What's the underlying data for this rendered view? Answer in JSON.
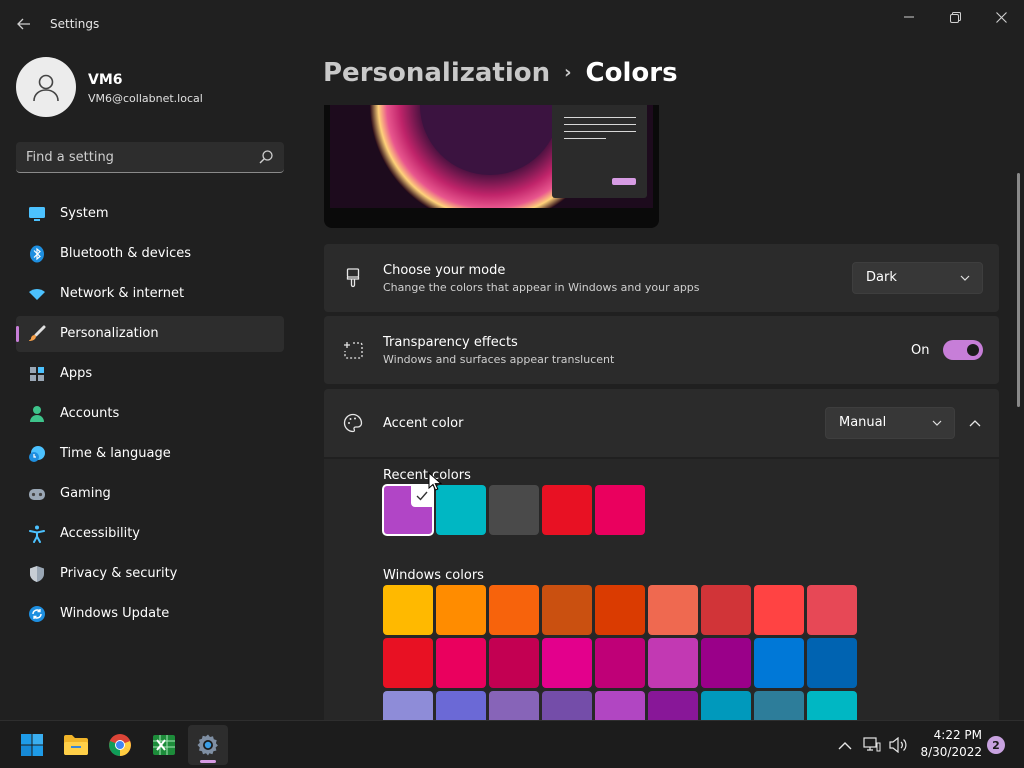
{
  "window": {
    "title": "Settings",
    "controls": [
      "minimize",
      "maximize",
      "close"
    ]
  },
  "profile": {
    "name": "VM6",
    "email": "VM6@collabnet.local"
  },
  "search": {
    "placeholder": "Find a setting",
    "icon": "search-icon"
  },
  "sidebar": {
    "active_item": "Personalization",
    "accent_color": "#c77ed8",
    "items": [
      {
        "label": "System",
        "icon": "monitor-icon"
      },
      {
        "label": "Bluetooth & devices",
        "icon": "bluetooth-icon"
      },
      {
        "label": "Network & internet",
        "icon": "wifi-icon"
      },
      {
        "label": "Personalization",
        "icon": "brush-icon"
      },
      {
        "label": "Apps",
        "icon": "apps-icon"
      },
      {
        "label": "Accounts",
        "icon": "person-icon"
      },
      {
        "label": "Time & language",
        "icon": "clock-globe-icon"
      },
      {
        "label": "Gaming",
        "icon": "gamepad-icon"
      },
      {
        "label": "Accessibility",
        "icon": "accessibility-icon"
      },
      {
        "label": "Privacy & security",
        "icon": "shield-icon"
      },
      {
        "label": "Windows Update",
        "icon": "sync-icon"
      }
    ]
  },
  "breadcrumb": {
    "parent": "Personalization",
    "separator": "›",
    "current": "Colors"
  },
  "mode_card": {
    "title": "Choose your mode",
    "description": "Change the colors that appear in Windows and your apps",
    "value": "Dark",
    "icon": "paintbrush-icon"
  },
  "transparency_card": {
    "title": "Transparency effects",
    "description": "Windows and surfaces appear translucent",
    "state": "On",
    "enabled": true,
    "icon": "sparkle-icon"
  },
  "accent_card": {
    "title": "Accent color",
    "value": "Manual",
    "icon": "palette-icon",
    "expanded": true
  },
  "recent_colors": {
    "label": "Recent colors",
    "colors": [
      "#b145c6",
      "#00b7c3",
      "#4a4a4a",
      "#e81123",
      "#ea005e"
    ],
    "selected_index": 0
  },
  "windows_colors": {
    "label": "Windows colors",
    "rows": [
      [
        "#ffb900",
        "#ff8c00",
        "#f7630c",
        "#ca5010",
        "#da3b01",
        "#ef6950",
        "#d13438",
        "#ff4343",
        "#e74856"
      ],
      [
        "#e81123",
        "#ea005e",
        "#c30052",
        "#e3008c",
        "#bf0077",
        "#c239b3",
        "#9a0089",
        "#0078d7",
        "#0063b1"
      ],
      [
        "#8e8cd8",
        "#6b69d6",
        "#8764b8",
        "#744da9",
        "#b146c2",
        "#881798",
        "#0099bc",
        "#2d7d9a",
        "#00b7c3"
      ]
    ]
  },
  "taskbar": {
    "apps": [
      {
        "name": "start",
        "icon": "windows-logo-icon"
      },
      {
        "name": "file-explorer",
        "icon": "folder-icon"
      },
      {
        "name": "chrome",
        "icon": "chrome-icon"
      },
      {
        "name": "spreadsheet",
        "icon": "spreadsheet-icon"
      },
      {
        "name": "settings",
        "icon": "gear-icon",
        "active": true
      }
    ],
    "tray": [
      "chevron-up-icon",
      "network-icon",
      "volume-icon"
    ],
    "time": "4:22 PM",
    "date": "8/30/2022",
    "notification_count": "2"
  }
}
